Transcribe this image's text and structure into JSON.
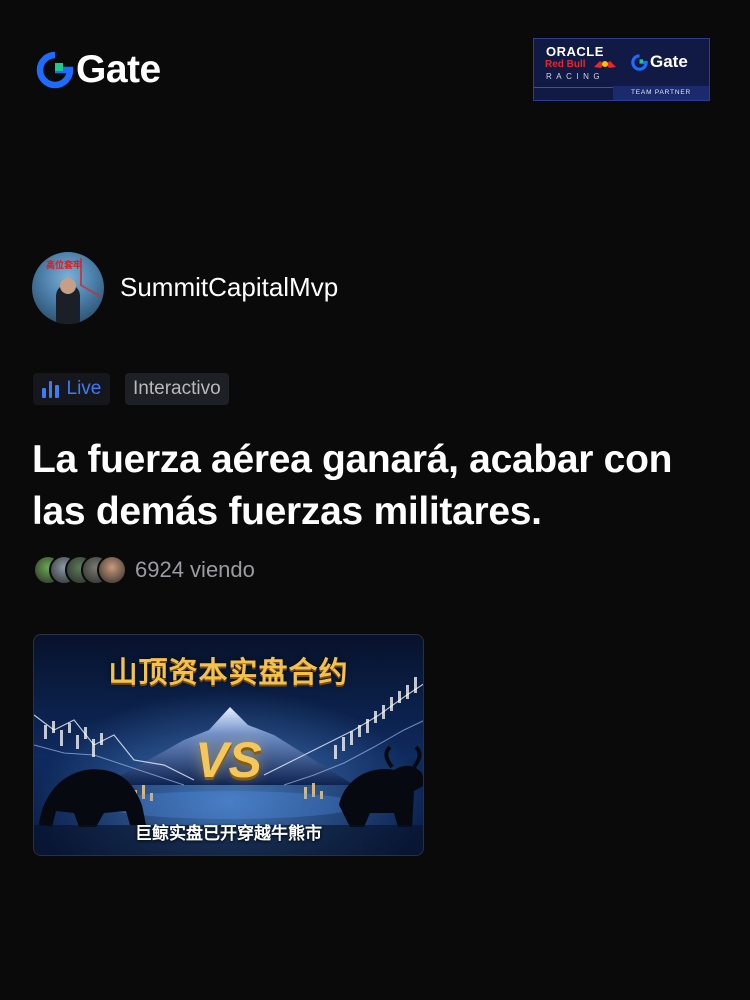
{
  "header": {
    "logo_text": "Gate",
    "partner": {
      "line1": "ORACLE",
      "line2": "Red Bull",
      "line3": "RACING",
      "brand": "Gate",
      "caption": "TEAM PARTNER"
    }
  },
  "profile": {
    "username": "SummitCapitalMvp",
    "avatar_caption": "高位套牢"
  },
  "tags": {
    "live": "Live",
    "category": "Interactivo"
  },
  "post": {
    "title": "La fuerza aérea ganará, acabar con las demás fuerzas militares."
  },
  "viewers": {
    "count_text": "6924 viendo",
    "avatar_colors": [
      "#6aa84f",
      "#8a9aa6",
      "#5c7a5a",
      "#7a7a72",
      "#c99a7a"
    ]
  },
  "banner": {
    "title": "山顶资本实盘合约",
    "center": "VS",
    "subtitle": "巨鲸实盘已开穿越牛熊市"
  },
  "colors": {
    "accent_blue": "#3d7cf5",
    "gate_brand": "#1e6bff",
    "background": "#0a0a0a"
  }
}
